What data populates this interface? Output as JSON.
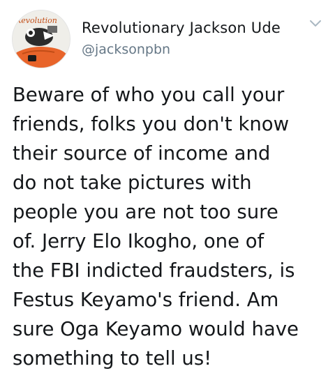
{
  "user": {
    "display_name": "Revolutionary Jackson Ude",
    "handle": "@jacksonpbn",
    "avatar_banner_text": "Revolution"
  },
  "tweet": {
    "text": "Beware of who you call your\nfriends, folks you don't know\ntheir source of income and\ndo not take pictures with\npeople you are not too sure\nof. Jerry Elo Ikogho, one of\nthe FBI indicted fraudsters, is\nFestus Keyamo's friend. Am\nsure Oga Keyamo would have\nsomething to tell us!"
  },
  "icons": {
    "menu": "chevron-down-icon"
  },
  "colors": {
    "name": "#14171a",
    "handle": "#657786",
    "caret": "#aab8c2",
    "avatar_accent": "#e8642a"
  }
}
